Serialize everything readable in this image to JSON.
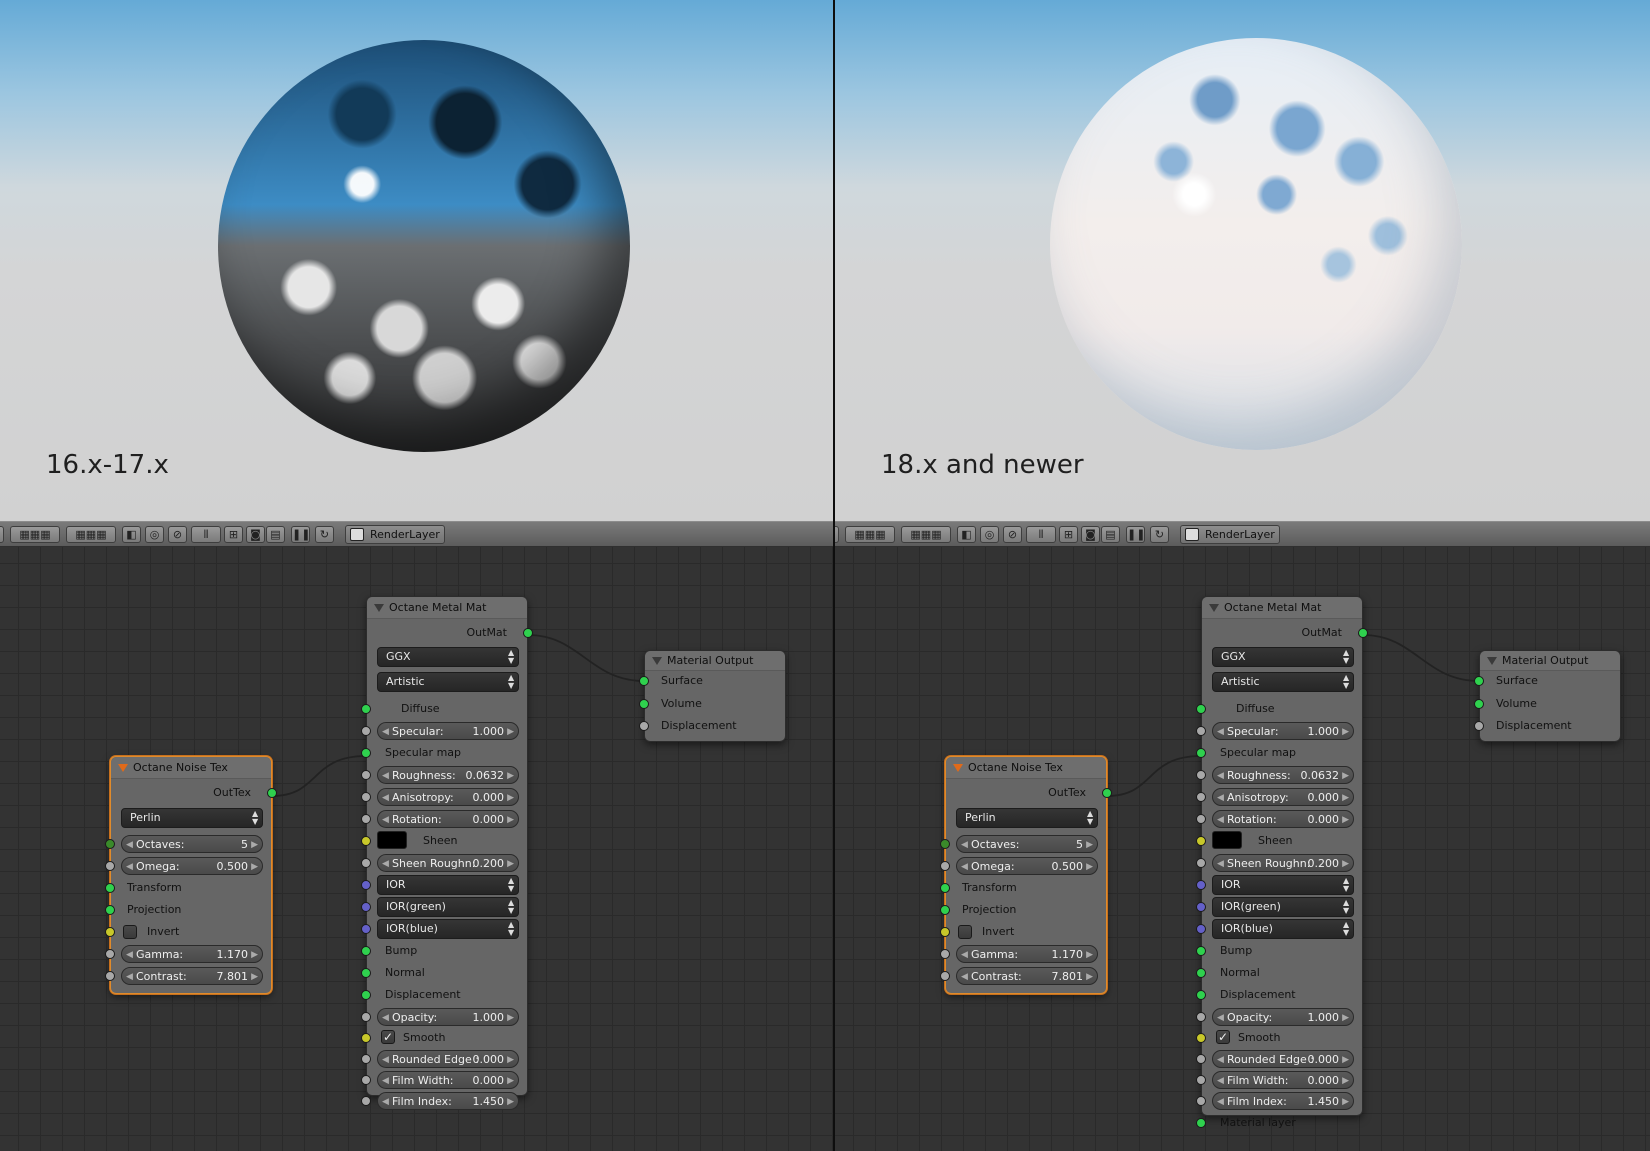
{
  "panels": [
    {
      "render_label": "16.x-17.x",
      "toolbar": {
        "render_layer": "RenderLayer"
      },
      "metal_node": {
        "title": "Octane Metal Mat",
        "output": "OutMat",
        "distribution": "GGX",
        "mode": "Artistic",
        "diffuse": "Diffuse",
        "specular": {
          "label": "Specular:",
          "value": "1.000"
        },
        "specular_map": "Specular map",
        "roughness": {
          "label": "Roughness:",
          "value": "0.0632"
        },
        "anisotropy": {
          "label": "Anisotropy:",
          "value": "0.000"
        },
        "rotation": {
          "label": "Rotation:",
          "value": "0.000"
        },
        "sheen": "Sheen",
        "sheen_roughness": {
          "label": "Sheen Roughn:",
          "value": "0.200"
        },
        "ior": "IOR",
        "ior_green": "IOR(green)",
        "ior_blue": "IOR(blue)",
        "bump": "Bump",
        "normal": "Normal",
        "displacement": "Displacement",
        "opacity": {
          "label": "Opacity:",
          "value": "1.000"
        },
        "smooth": "Smooth",
        "rounded_edge": {
          "label": "Rounded Edge :",
          "value": "0.000"
        },
        "film_width": {
          "label": "Film Width:",
          "value": "0.000"
        },
        "film_index": {
          "label": "Film Index:",
          "value": "1.450"
        },
        "material_layer": ""
      },
      "noise_node": {
        "title": "Octane Noise Tex",
        "output": "OutTex",
        "type": "Perlin",
        "octaves": {
          "label": "Octaves:",
          "value": "5"
        },
        "omega": {
          "label": "Omega:",
          "value": "0.500"
        },
        "transform": "Transform",
        "projection": "Projection",
        "invert": "Invert",
        "gamma": {
          "label": "Gamma:",
          "value": "1.170"
        },
        "contrast": {
          "label": "Contrast:",
          "value": "7.801"
        }
      },
      "output_node": {
        "title": "Material Output",
        "surface": "Surface",
        "volume": "Volume",
        "displacement": "Displacement"
      }
    },
    {
      "render_label": "18.x and newer",
      "toolbar": {
        "render_layer": "RenderLayer"
      },
      "metal_node": {
        "title": "Octane Metal Mat",
        "output": "OutMat",
        "distribution": "GGX",
        "mode": "Artistic",
        "diffuse": "Diffuse",
        "specular": {
          "label": "Specular:",
          "value": "1.000"
        },
        "specular_map": "Specular map",
        "roughness": {
          "label": "Roughness:",
          "value": "0.0632"
        },
        "anisotropy": {
          "label": "Anisotropy:",
          "value": "0.000"
        },
        "rotation": {
          "label": "Rotation:",
          "value": "0.000"
        },
        "sheen": "Sheen",
        "sheen_roughness": {
          "label": "Sheen Roughn:",
          "value": "0.200"
        },
        "ior": "IOR",
        "ior_green": "IOR(green)",
        "ior_blue": "IOR(blue)",
        "bump": "Bump",
        "normal": "Normal",
        "displacement": "Displacement",
        "opacity": {
          "label": "Opacity:",
          "value": "1.000"
        },
        "smooth": "Smooth",
        "rounded_edge": {
          "label": "Rounded Edge :",
          "value": "0.000"
        },
        "film_width": {
          "label": "Film Width:",
          "value": "0.000"
        },
        "film_index": {
          "label": "Film Index:",
          "value": "1.450"
        },
        "material_layer": "Material layer"
      },
      "noise_node": {
        "title": "Octane Noise Tex",
        "output": "OutTex",
        "type": "Perlin",
        "octaves": {
          "label": "Octaves:",
          "value": "5"
        },
        "omega": {
          "label": "Omega:",
          "value": "0.500"
        },
        "transform": "Transform",
        "projection": "Projection",
        "invert": "Invert",
        "gamma": {
          "label": "Gamma:",
          "value": "1.170"
        },
        "contrast": {
          "label": "Contrast:",
          "value": "7.801"
        }
      },
      "output_node": {
        "title": "Material Output",
        "surface": "Surface",
        "volume": "Volume",
        "displacement": "Displacement"
      }
    }
  ],
  "colors": {
    "socket_shader": "#2fd14e",
    "socket_float": "#a8a8a8",
    "socket_color": "#c8c82a",
    "socket_vector": "#6460c8",
    "selected_outline": "#e08b2b"
  }
}
